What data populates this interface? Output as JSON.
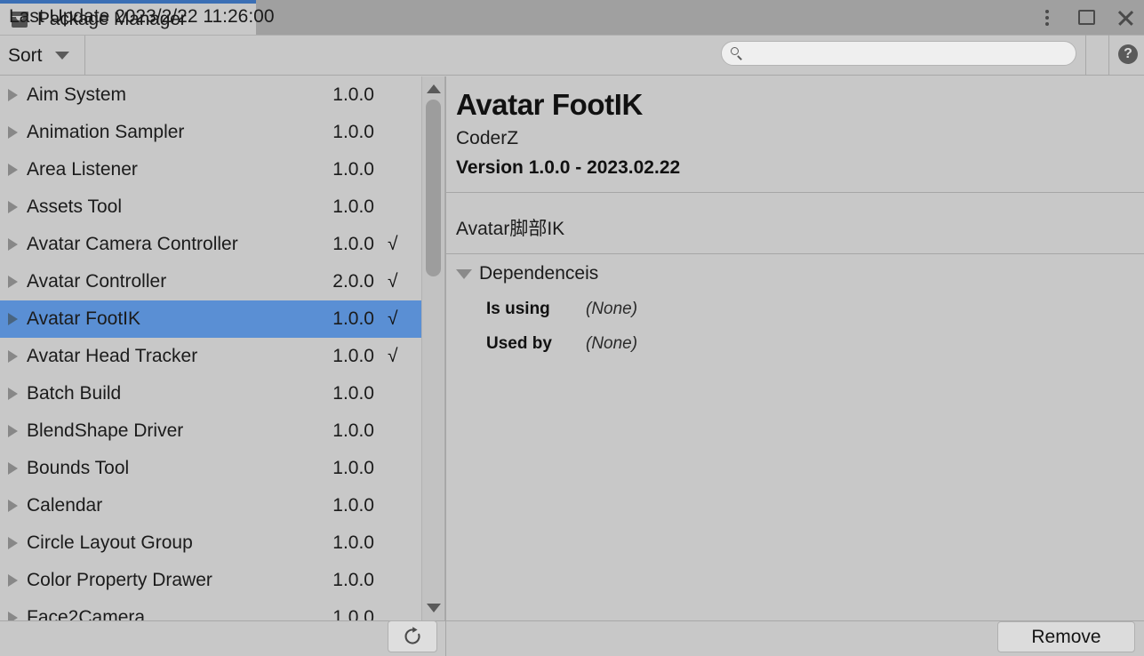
{
  "window": {
    "tab_title": "Package Manager",
    "tab_icon": "package-box-icon",
    "accent_color": "#3b6fb5",
    "controls": {
      "menu": "kebab-menu-icon",
      "maximize": "maximize-icon",
      "close": "close-icon"
    }
  },
  "toolbar": {
    "sort_label": "Sort",
    "sort_caret": "chevron-down-icon",
    "search_value": "",
    "search_placeholder": "",
    "help_label": "?"
  },
  "packages": {
    "selected_index": 6,
    "items": [
      {
        "name": "Aim System",
        "version": "1.0.0",
        "installed": ""
      },
      {
        "name": "Animation Sampler",
        "version": "1.0.0",
        "installed": ""
      },
      {
        "name": "Area Listener",
        "version": "1.0.0",
        "installed": ""
      },
      {
        "name": "Assets Tool",
        "version": "1.0.0",
        "installed": ""
      },
      {
        "name": "Avatar Camera Controller",
        "version": "1.0.0",
        "installed": "√"
      },
      {
        "name": "Avatar Controller",
        "version": "2.0.0",
        "installed": "√"
      },
      {
        "name": "Avatar FootIK",
        "version": "1.0.0",
        "installed": "√"
      },
      {
        "name": "Avatar Head Tracker",
        "version": "1.0.0",
        "installed": "√"
      },
      {
        "name": "Batch Build",
        "version": "1.0.0",
        "installed": ""
      },
      {
        "name": "BlendShape Driver",
        "version": "1.0.0",
        "installed": ""
      },
      {
        "name": "Bounds Tool",
        "version": "1.0.0",
        "installed": ""
      },
      {
        "name": "Calendar",
        "version": "1.0.0",
        "installed": ""
      },
      {
        "name": "Circle Layout Group",
        "version": "1.0.0",
        "installed": ""
      },
      {
        "name": "Color Property Drawer",
        "version": "1.0.0",
        "installed": ""
      },
      {
        "name": "Face2Camera",
        "version": "1.0.0",
        "installed": ""
      }
    ]
  },
  "detail": {
    "title": "Avatar FootIK",
    "author": "CoderZ",
    "version_line": "Version 1.0.0 - 2023.02.22",
    "description": "Avatar脚部IK",
    "dependencies": {
      "heading": "Dependenceis",
      "rows": [
        {
          "key": "Is using",
          "value": "(None)"
        },
        {
          "key": "Used by",
          "value": "(None)"
        }
      ]
    }
  },
  "status": {
    "last_update": "Last Update 2023/2/22 11:26:00",
    "refresh_icon": "refresh-icon",
    "remove_label": "Remove"
  },
  "colors": {
    "selection": "#5a8fd4",
    "panel_bg": "#c8c8c8",
    "chrome_bg": "#a0a0a0"
  }
}
